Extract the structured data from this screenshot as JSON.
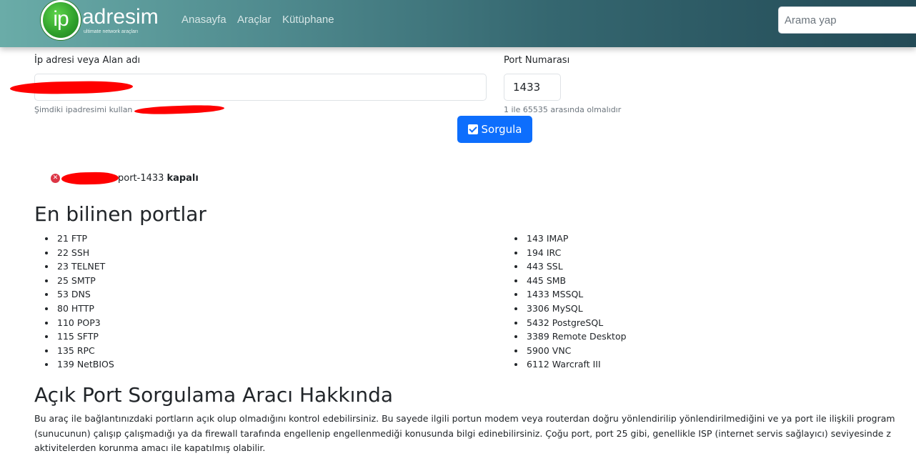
{
  "header": {
    "logo_ip": "ip",
    "logo_name": "adresim",
    "logo_tagline": "ultimate network araçları",
    "nav": [
      "Anasayfa",
      "Araçlar",
      "Kütüphane"
    ],
    "search_placeholder": "Arama yap"
  },
  "form": {
    "ip_label": "İp adresi veya Alan adı",
    "ip_value": "",
    "ip_help": "Şimdiki ipadresimi kullan",
    "port_label": "Port Numarası",
    "port_value": "1433",
    "port_help": "1 ile 65535 arasında olmalıdır",
    "submit_label": "Sorgula"
  },
  "result": {
    "prefix": "port-1433",
    "status": "kapalı"
  },
  "ports_section": {
    "title": "En bilinen portlar",
    "left": [
      "21 FTP",
      "22 SSH",
      "23 TELNET",
      "25 SMTP",
      "53 DNS",
      "80 HTTP",
      "110 POP3",
      "115 SFTP",
      "135 RPC",
      "139 NetBIOS"
    ],
    "right": [
      "143 IMAP",
      "194 IRC",
      "443 SSL",
      "445 SMB",
      "1433 MSSQL",
      "3306 MySQL",
      "5432 PostgreSQL",
      "3389 Remote Desktop",
      "5900 VNC",
      "6112 Warcraft III"
    ]
  },
  "about_section": {
    "title": "Açık Port Sorgulama Aracı Hakkında",
    "lines": [
      "Bu araç ile bağlantınızdaki portların açık olup olmadığını kontrol edebilirsiniz. Bu sayede ilgili portun modem veya routerdan doğru yönlendirilip yönlendirilmediğini ve ya port ile ilişkili program",
      "(sunucunun) çalışıp çalışmadığı ya da firewall tarafında engellenip engellenmediği konusunda bilgi edinebilirsiniz. Çoğu port, port 25 gibi, genellikle ISP (internet servis sağlayıcı) seviyesinde z",
      "aktivitelerden korunma amacı ile kapatılmış olabilir."
    ]
  },
  "colors": {
    "primary": "#0d6efd",
    "danger": "#dc3545",
    "redaction": "#ff0000"
  }
}
